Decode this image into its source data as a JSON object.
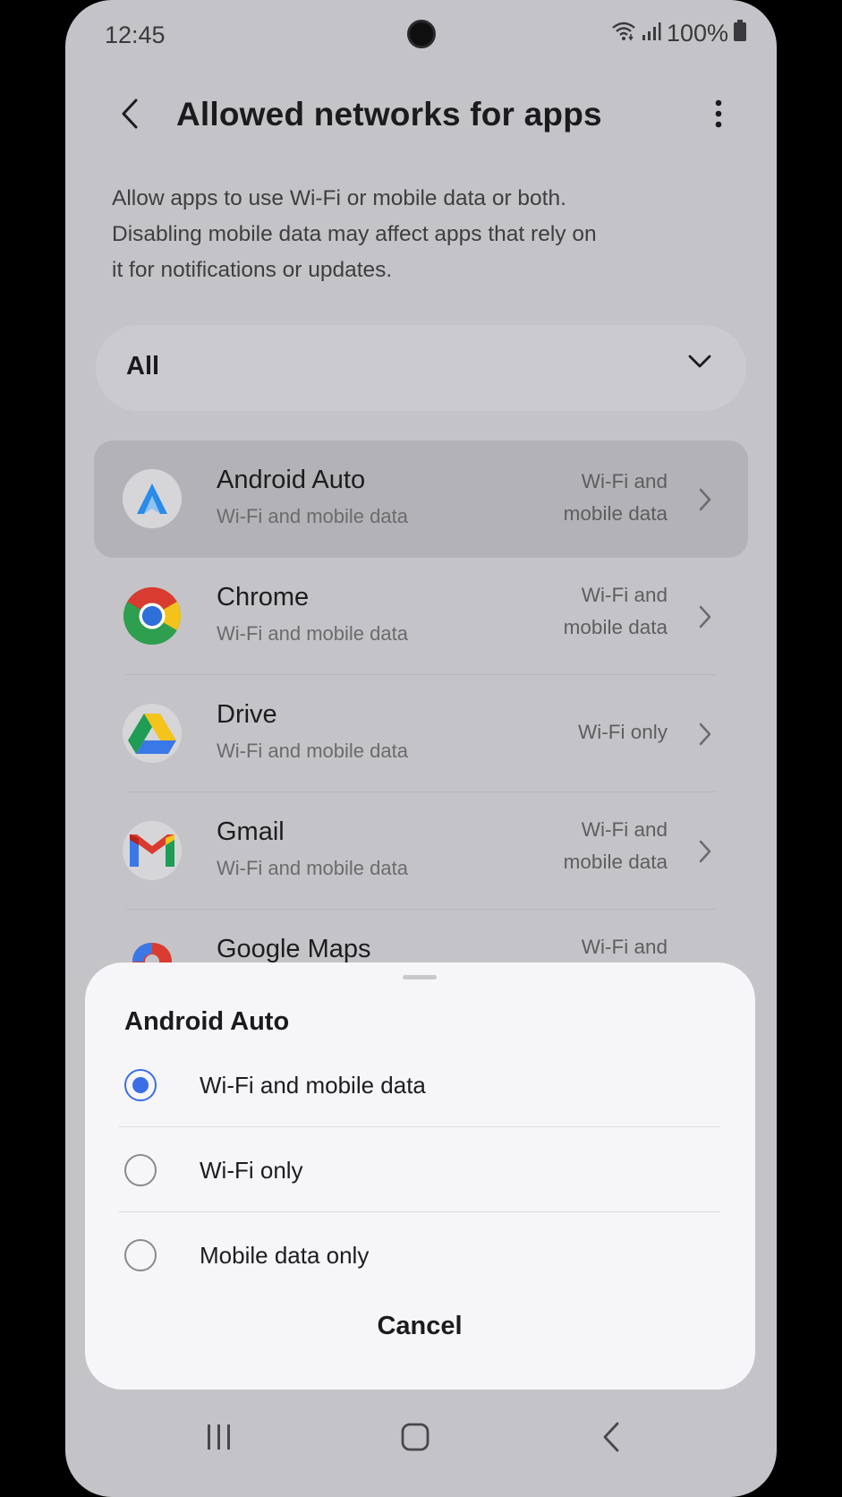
{
  "status": {
    "time": "12:45",
    "battery": "100%"
  },
  "header": {
    "title": "Allowed networks for apps"
  },
  "description": "Allow apps to use Wi-Fi or mobile data or both. Disabling mobile data may affect apps that rely on it for notifications or updates.",
  "filter": {
    "selected": "All"
  },
  "apps": [
    {
      "name": "Android Auto",
      "subtitle": "Wi-Fi and mobile data",
      "value": "Wi-Fi and mobile data",
      "icon": "android-auto-icon"
    },
    {
      "name": "Chrome",
      "subtitle": "Wi-Fi and mobile data",
      "value": "Wi-Fi and mobile data",
      "icon": "chrome-icon"
    },
    {
      "name": "Drive",
      "subtitle": "Wi-Fi and mobile data",
      "value": "Wi-Fi only",
      "icon": "drive-icon"
    },
    {
      "name": "Gmail",
      "subtitle": "Wi-Fi and mobile data",
      "value": "Wi-Fi and mobile data",
      "icon": "gmail-icon"
    },
    {
      "name": "Google Maps",
      "subtitle": "",
      "value": "Wi-Fi and",
      "icon": "google-maps-icon"
    }
  ],
  "sheet": {
    "title": "Android Auto",
    "options": [
      {
        "label": "Wi-Fi and mobile data",
        "selected": true
      },
      {
        "label": "Wi-Fi only",
        "selected": false
      },
      {
        "label": "Mobile data only",
        "selected": false
      }
    ],
    "cancel_label": "Cancel"
  },
  "colors": {
    "accent": "#3a6ee8",
    "scrim_background": "#c4c4c8",
    "sheet_background": "#f6f6f8"
  }
}
